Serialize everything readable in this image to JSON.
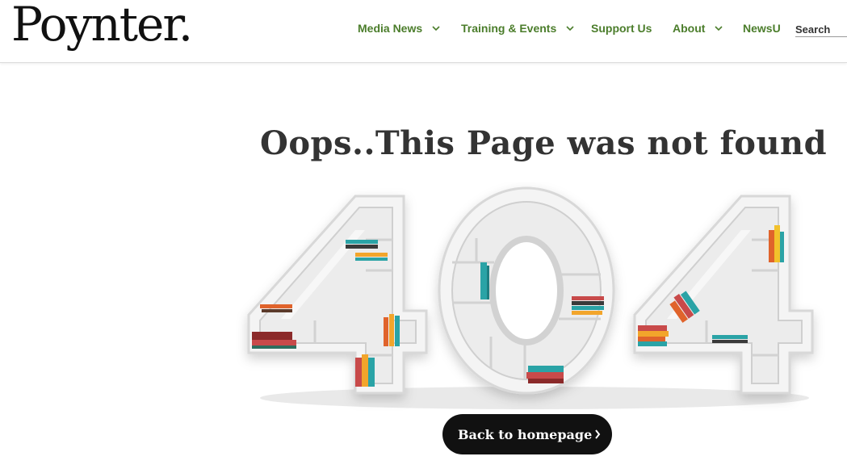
{
  "header": {
    "logo_text": "Poynter.",
    "nav": [
      {
        "label": "Media News",
        "has_dropdown": true
      },
      {
        "label": "Training & Events",
        "has_dropdown": true
      },
      {
        "label": "Support Us",
        "has_dropdown": false
      },
      {
        "label": "About",
        "has_dropdown": true
      },
      {
        "label": "NewsU",
        "has_dropdown": false
      }
    ],
    "search_placeholder": "Search"
  },
  "main": {
    "title": "Oops..This Page was not found",
    "illustration_text": "404",
    "back_button_label": "Back to homepage"
  },
  "colors": {
    "nav_green": "#4b7d2b",
    "button_bg": "#111111",
    "shelf_white": "#f2f2f2"
  },
  "icons": [
    "chevron-down-icon",
    "chevron-right-icon"
  ]
}
